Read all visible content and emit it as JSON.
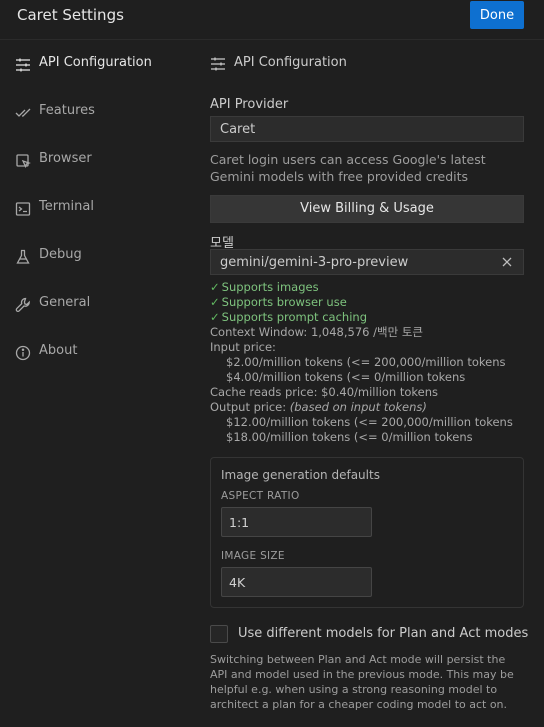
{
  "header": {
    "title": "Caret Settings",
    "done_label": "Done"
  },
  "sidebar": {
    "items": [
      {
        "label": "API Configuration",
        "icon": "sliders-icon",
        "active": true
      },
      {
        "label": "Features",
        "icon": "check-check-icon"
      },
      {
        "label": "Browser",
        "icon": "browser-pointer-icon"
      },
      {
        "label": "Terminal",
        "icon": "terminal-icon"
      },
      {
        "label": "Debug",
        "icon": "flask-icon"
      },
      {
        "label": "General",
        "icon": "wrench-icon"
      },
      {
        "label": "About",
        "icon": "info-icon"
      }
    ]
  },
  "main": {
    "section_title": "API Configuration",
    "provider": {
      "label": "API Provider",
      "value": "Caret"
    },
    "login_note": "Caret login users can access Google's latest Gemini models with free provided credits",
    "billing_button": "View Billing & Usage",
    "model": {
      "label": "모델",
      "value": "gemini/gemini-3-pro-preview"
    },
    "capabilities": [
      "Supports images",
      "Supports browser use",
      "Supports prompt caching"
    ],
    "context_window": "Context Window: 1,048,576 /백만 토큰",
    "input_price_label": "Input price:",
    "input_prices": [
      "$2.00/million tokens (<= 200,000/million tokens",
      "$4.00/million tokens (<= 0/million tokens"
    ],
    "cache_reads": "Cache reads price: $0.40/million tokens",
    "output_price_label": "Output price:",
    "output_price_note": "(based on input tokens)",
    "output_prices": [
      "$12.00/million tokens (<= 200,000/million tokens",
      "$18.00/million tokens (<= 0/million tokens"
    ],
    "image_defaults": {
      "title": "Image generation defaults",
      "aspect_label": "ASPECT RATIO",
      "aspect_value": "1:1",
      "size_label": "IMAGE SIZE",
      "size_value": "4K"
    },
    "plan_act_label": "Use different models for Plan and Act modes",
    "plan_act_checked": false,
    "footer_note": "Switching between Plan and Act mode will persist the API and model used in the previous mode. This may be helpful e.g. when using a strong reasoning model to architect a plan for a cheaper coding model to act on."
  }
}
